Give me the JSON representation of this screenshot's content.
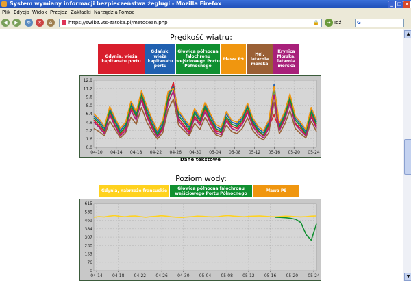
{
  "window": {
    "title": "System wymiany informacji bezpieczeństwa żeglugi - Mozilla Firefox"
  },
  "menu": [
    "Plik",
    "Edycja",
    "Widok",
    "Przejdź",
    "Zakładki",
    "Narzędzia",
    "Pomoc"
  ],
  "nav": {
    "url": "https://swibz.vts-zatoka.pl/metocean.php",
    "go_label": "Idź",
    "search_value": "G"
  },
  "wind": {
    "title": "Prędkość wiatru:",
    "legend": [
      {
        "label": "Gdynia, wieża kapitanatu portu",
        "color": "#d81e2c"
      },
      {
        "label": "Gdańsk, wieża kapitanatu portu",
        "color": "#2060b0"
      },
      {
        "label": "Głowica północna falochronu wejściowego Portu Północnego",
        "color": "#109030"
      },
      {
        "label": "Pława P9",
        "color": "#f0960f"
      },
      {
        "label": "Hel, latarnia morska",
        "color": "#9a6035"
      },
      {
        "label": "Krynica Morska, latarnia morska",
        "color": "#a8207a"
      }
    ],
    "link": "Dane tekstowe"
  },
  "water": {
    "title": "Poziom wody:",
    "legend": [
      {
        "label": "Gdynia, nabrzeże francuskie",
        "color": "#ffd21e"
      },
      {
        "label": "Głowica północna falochronu wejściowego Portu Północnego",
        "color": "#109030"
      },
      {
        "label": "Pława P9",
        "color": "#f0960f"
      }
    ]
  },
  "chart_data": [
    {
      "type": "line",
      "x_labels": [
        "04-10",
        "04-14",
        "04-18",
        "04-22",
        "04-26",
        "04-30",
        "05-04",
        "05-08",
        "05-12",
        "05-16",
        "05-20",
        "05-24"
      ],
      "ylim": [
        0,
        12.8
      ],
      "y_ticks": [
        0.0,
        1.6,
        3.2,
        4.8,
        6.4,
        8.0,
        9.6,
        11.2,
        12.8
      ],
      "y_tick_labels": [
        "0.0",
        "1.6",
        "3.2",
        "4.8",
        "6.4",
        "8.0",
        "9.6",
        "11.2",
        "12.8"
      ],
      "grid": true,
      "series": [
        {
          "name": "Gdynia, wieża kapitanatu portu",
          "color": "#d81e2c",
          "values": [
            5.2,
            4.1,
            3.0,
            6.8,
            4.2,
            2.5,
            3.6,
            7.5,
            5.8,
            9.6,
            6.2,
            4.0,
            2.1,
            3.8,
            9.0,
            12.4,
            5.5,
            4.2,
            3.0,
            6.0,
            4.6,
            7.4,
            5.0,
            3.2,
            2.8,
            5.4,
            4.0,
            3.6,
            4.8,
            7.0,
            4.4,
            3.0,
            2.2,
            4.0,
            6.2,
            3.4,
            5.6,
            8.8,
            4.6,
            3.6,
            2.4,
            6.2,
            4.0
          ]
        },
        {
          "name": "Gdańsk, wieża kapitanatu portu",
          "color": "#2060b0",
          "values": [
            6.0,
            5.0,
            3.6,
            7.4,
            5.2,
            3.2,
            4.4,
            8.4,
            6.4,
            10.4,
            7.4,
            5.0,
            2.8,
            4.8,
            10.2,
            11.6,
            6.6,
            5.2,
            3.8,
            7.0,
            5.4,
            8.2,
            6.0,
            4.0,
            3.4,
            6.4,
            4.8,
            4.4,
            5.6,
            8.0,
            5.2,
            3.6,
            2.8,
            4.8,
            12.0,
            4.2,
            6.4,
            9.8,
            5.6,
            4.4,
            3.0,
            7.2,
            4.8
          ]
        },
        {
          "name": "Głowica północna falochronu wejściowego Portu Północnego",
          "color": "#109030",
          "values": [
            5.6,
            4.6,
            3.2,
            7.0,
            4.8,
            2.8,
            4.0,
            8.0,
            6.0,
            10.0,
            6.8,
            4.4,
            2.4,
            4.2,
            9.6,
            11.4,
            6.0,
            4.8,
            3.4,
            6.6,
            5.0,
            7.8,
            5.4,
            3.6,
            3.0,
            5.8,
            4.4,
            4.0,
            5.2,
            7.6,
            4.8,
            3.2,
            2.4,
            4.4,
            11.2,
            3.8,
            6.0,
            9.4,
            5.2,
            4.0,
            2.6,
            6.8,
            4.4
          ]
        },
        {
          "name": "Pława P9",
          "color": "#f0960f",
          "values": [
            6.4,
            5.4,
            4.0,
            7.8,
            5.6,
            3.6,
            4.8,
            8.8,
            6.8,
            10.8,
            7.8,
            5.4,
            3.2,
            5.2,
            10.6,
            11.2,
            7.0,
            5.6,
            4.2,
            7.4,
            5.8,
            8.6,
            6.4,
            4.4,
            3.8,
            6.8,
            5.2,
            4.8,
            6.0,
            8.4,
            5.6,
            4.0,
            3.2,
            5.2,
            11.6,
            4.6,
            6.8,
            10.2,
            6.0,
            4.8,
            3.4,
            7.6,
            5.2
          ]
        },
        {
          "name": "Hel, latarnia morska",
          "color": "#9a6035",
          "values": [
            3.6,
            3.0,
            2.2,
            5.0,
            3.4,
            1.8,
            2.8,
            5.8,
            4.4,
            7.6,
            4.8,
            3.0,
            1.6,
            2.8,
            7.2,
            9.2,
            4.2,
            3.2,
            2.2,
            4.6,
            3.4,
            5.8,
            3.8,
            2.4,
            2.0,
            4.2,
            3.0,
            2.6,
            3.6,
            5.6,
            3.2,
            2.0,
            1.4,
            2.8,
            8.6,
            2.6,
            4.4,
            7.0,
            3.6,
            2.6,
            1.8,
            5.0,
            3.0
          ]
        },
        {
          "name": "Krynica Morska, latarnia morska",
          "color": "#a8207a",
          "values": [
            4.8,
            3.8,
            2.6,
            6.2,
            4.0,
            2.2,
            3.2,
            7.0,
            5.2,
            9.0,
            5.8,
            3.6,
            2.0,
            3.4,
            8.4,
            10.8,
            5.0,
            3.8,
            2.6,
            5.6,
            4.2,
            6.8,
            4.6,
            2.8,
            2.4,
            5.0,
            3.6,
            3.2,
            4.4,
            6.6,
            4.0,
            2.6,
            1.8,
            3.6,
            10.0,
            3.2,
            5.2,
            8.4,
            4.4,
            3.2,
            2.2,
            5.8,
            3.6
          ]
        }
      ]
    },
    {
      "type": "line",
      "x_labels": [
        "04-14",
        "04-18",
        "04-22",
        "04-26",
        "04-30",
        "05-04",
        "05-08",
        "05-12",
        "05-16",
        "05-20",
        "05-24"
      ],
      "ylim": [
        0,
        615
      ],
      "y_ticks": [
        0,
        76,
        153,
        230,
        307,
        384,
        461,
        538,
        615
      ],
      "y_tick_labels": [
        "0",
        "76",
        "153",
        "230",
        "307",
        "384",
        "461",
        "538",
        "615"
      ],
      "grid": true,
      "series": [
        {
          "name": "Gdynia, nabrzeże francuskie",
          "color": "#ffd21e",
          "values": [
            490,
            496,
            492,
            500,
            505,
            498,
            494,
            500,
            502,
            496,
            490,
            495,
            498,
            504,
            500,
            494,
            490,
            488,
            492,
            496,
            500,
            498,
            495,
            493,
            496,
            502,
            505,
            500,
            497,
            494,
            498,
            500,
            502,
            499,
            496,
            494,
            497,
            500,
            498,
            495,
            493,
            496,
            500,
            502
          ]
        },
        {
          "name": "Głowica północna falochronu wejściowego Portu Północnego",
          "color": "#109030",
          "values": [
            null,
            null,
            null,
            null,
            null,
            null,
            null,
            null,
            null,
            null,
            null,
            null,
            null,
            null,
            null,
            null,
            null,
            null,
            null,
            null,
            null,
            null,
            null,
            null,
            null,
            null,
            null,
            null,
            null,
            null,
            null,
            null,
            null,
            null,
            null,
            490,
            488,
            485,
            480,
            470,
            440,
            330,
            280,
            430
          ]
        }
      ]
    }
  ]
}
